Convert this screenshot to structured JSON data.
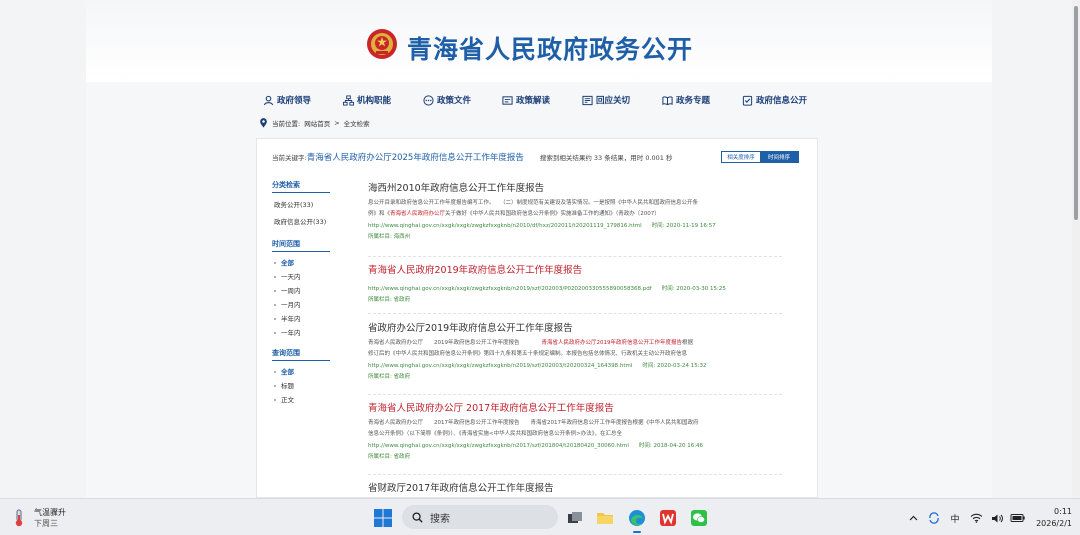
{
  "site": {
    "title": "青海省人民政府政务公开"
  },
  "nav": [
    {
      "label": "政府领导",
      "icon": "person-icon"
    },
    {
      "label": "机构职能",
      "icon": "org-chart-icon"
    },
    {
      "label": "政策文件",
      "icon": "chat-bubble-icon"
    },
    {
      "label": "政策解读",
      "icon": "document-read-icon"
    },
    {
      "label": "回应关切",
      "icon": "reply-box-icon"
    },
    {
      "label": "政务专题",
      "icon": "book-icon"
    },
    {
      "label": "政府信息公开",
      "icon": "checklist-icon"
    }
  ],
  "breadcrumb": {
    "prefix": "当前位置:",
    "home": "网站首页",
    "sep": ">",
    "current": "全文检索"
  },
  "summary": {
    "keyword_label": "当前关键字:",
    "keyword": "青海省人民政府办公厅2025年政府信息公开工作年度报告",
    "count_text": "搜索到相关结果约 33 条结果，用时 0.001 秒"
  },
  "sort": {
    "relevance": "相关度排序",
    "time": "时间排序"
  },
  "sidebar": {
    "category": {
      "head": "分类检索",
      "items": [
        "政务公开(33)",
        "政府信息公开(33)"
      ]
    },
    "time": {
      "head": "时间范围",
      "items": [
        "全部",
        "一天内",
        "一周内",
        "一月内",
        "半年内",
        "一年内"
      ]
    },
    "scope": {
      "head": "查询范围",
      "items": [
        "全部",
        "标题",
        "正文"
      ]
    }
  },
  "results": [
    {
      "title": "海西州2010年政府信息公开工作年度报告",
      "snippet1": "息公开目录和政府信息公开工作年度报告编写工作。　　（二）制度规范有关建设及落实情况。一是按照《中华人民共和国政府信息公开条",
      "snippet2_pre": "例》和《",
      "snippet2_hl": "青海省人民政府办公厅",
      "snippet2_post": "关于做好《中华人民共和国政府信息公开条例》实施准备工作的通知》（青政办〔2007〕",
      "url": "http://www.qinghai.gov.cn/xxgk/xxgk/zwgkzfxxgknb/n2010/df/hxz/202011/t20201119_179816.html",
      "time": "时间: 2020-11-19 16:57",
      "column": "所属栏目: 海西州"
    },
    {
      "title": "青海省人民政府2019年政府信息公开工作年度报告",
      "url": "http://www.qinghai.gov.cn/xxgk/xxgk/zwgkzfxxgknb/n2019/szf/202003/P020200330555890058368.pdf",
      "time": "时间: 2020-03-30 15:25",
      "column": "所属栏目: 省政府"
    },
    {
      "title": "省政府办公厅2019年政府信息公开工作年度报告",
      "snippet1_pre": "青海省人民政府办公厅　　2019年政府信息公开工作年度报告　　　　",
      "snippet1_hl": "青海省人民政府办公厅2019年政府信息公开工作年度报告",
      "snippet1_post": "根据",
      "snippet2": "修订后的《中华人民共和国政府信息公开条例》第四十九条和第五十条规定编制。本报告包括总体情况、行政机关主动公开政府信息",
      "url": "http://www.qinghai.gov.cn/xxgk/xxgk/zwgkzfxxgknb/n2019/szf/202003/t20200324_164398.html",
      "time": "时间: 2020-03-24 15:32",
      "column": "所属栏目: 省政府"
    },
    {
      "title": "青海省人民政府办公厅 2017年政府信息公开工作年度报告",
      "snippet1": "青海省人民政府办公厅　　2017年政府信息公开工作年度报告　　青海省2017年政府信息公开工作年度报告根据《中华人民共和国政府",
      "snippet2": "信息公开条例》（以下简称《条例》）、《青海省实施<中华人民共和国政府信息公开条例>办法》，在汇总全",
      "url": "http://www.qinghai.gov.cn/xxgk/xxgk/zwgkzfxxgknb/n2017/szf/201804/t20180420_30060.html",
      "time": "时间: 2018-04-20 16:46",
      "column": "所属栏目: 省政府"
    },
    {
      "title": "省财政厅2017年政府信息公开工作年度报告"
    }
  ],
  "taskbar": {
    "weather_line1": "气温骤升",
    "weather_line2": "下周三",
    "search": "搜索",
    "ime": "中",
    "time": "0:11",
    "date": "2026/2/1"
  }
}
